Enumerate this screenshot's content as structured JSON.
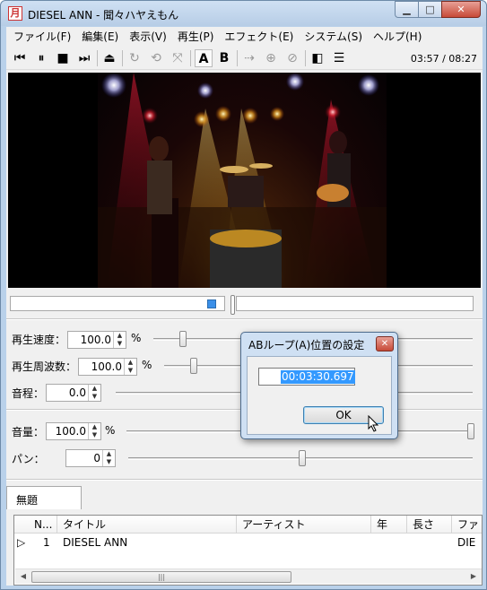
{
  "window": {
    "title": "DIESEL ANN - 聞々ハヤえもん",
    "app_icon_glyph": "月",
    "min_glyph": "▁",
    "max_glyph": "□",
    "close_glyph": "✕"
  },
  "menu": [
    "ファイル(F)",
    "編集(E)",
    "表示(V)",
    "再生(P)",
    "エフェクト(E)",
    "システム(S)",
    "ヘルプ(H)"
  ],
  "toolbar": {
    "buttons": [
      {
        "name": "previous-icon",
        "glyph": "⏮"
      },
      {
        "name": "pause-icon",
        "glyph": "⏸"
      },
      {
        "name": "stop-icon",
        "glyph": "■"
      },
      {
        "name": "next-icon",
        "glyph": "⏭"
      },
      {
        "name": "eject-icon",
        "glyph": "⏏"
      },
      {
        "name": "loop-one-icon",
        "glyph": "↻"
      },
      {
        "name": "loop-all-icon",
        "glyph": "⟲"
      },
      {
        "name": "random-icon",
        "glyph": "⤧"
      },
      {
        "name": "ab-loop-a-icon",
        "glyph": "A"
      },
      {
        "name": "ab-loop-b-icon",
        "glyph": "B"
      },
      {
        "name": "marker-play-icon",
        "glyph": "⇢"
      },
      {
        "name": "marker-add-icon",
        "glyph": "⊕"
      },
      {
        "name": "marker-remove-icon",
        "glyph": "⊘"
      },
      {
        "name": "explorer-icon",
        "glyph": "◧"
      },
      {
        "name": "playlist-icon",
        "glyph": "☰"
      }
    ],
    "time": "03:57 / 08:27"
  },
  "seek": {
    "position_fraction": 0.47
  },
  "controls": {
    "speed_label": "再生速度：",
    "speed_value": "100.0",
    "speed_unit": "%",
    "freq_label": "再生周波数：",
    "freq_value": "100.0",
    "freq_unit": "%",
    "pitch_label": "音程：",
    "pitch_value": "0.0",
    "volume_label": "音量：",
    "volume_value": "100.0",
    "volume_unit": "%",
    "pan_label": "パン：",
    "pan_value": "0",
    "spin_up": "▲",
    "spin_down": "▼"
  },
  "playlist": {
    "tab_label": "無題",
    "columns": [
      "N...",
      "タイトル",
      "アーティスト",
      "年",
      "長さ",
      "ファ"
    ],
    "rows": [
      {
        "marker": "▷",
        "no": "1",
        "title": "DIESEL ANN",
        "artist": "",
        "year": "",
        "length": "",
        "file": "DIE"
      }
    ],
    "scroll_left": "◀",
    "scroll_right": "▶",
    "scroll_grip": "|||"
  },
  "dialog": {
    "title": "ABループ(A)位置の設定",
    "close_glyph": "✕",
    "value": "00:03:30.697",
    "ok_label": "OK"
  }
}
